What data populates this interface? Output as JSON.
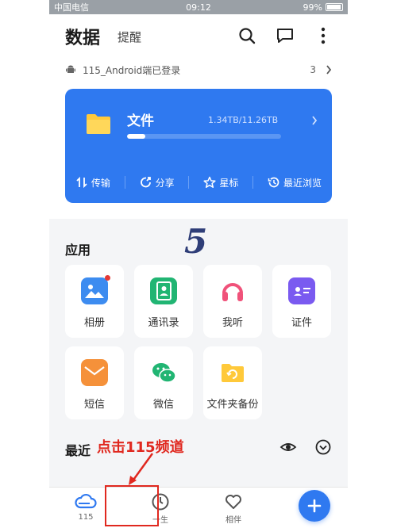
{
  "status_bar": {
    "carrier": "中国电信",
    "time": "09:12",
    "battery": "99%"
  },
  "header": {
    "title": "数据",
    "tab": "提醒"
  },
  "device": {
    "label": "115_Android端已登录",
    "count": "3"
  },
  "card": {
    "name": "文件",
    "usage": "1.34TB/11.26TB",
    "progress_fraction": 0.12,
    "actions": [
      "传输",
      "分享",
      "星标",
      "最近浏览"
    ]
  },
  "watermark": "5",
  "apps": {
    "title": "应用",
    "items": [
      "相册",
      "通讯录",
      "我听",
      "证件",
      "短信",
      "微信",
      "文件夹备份"
    ]
  },
  "recent": {
    "title": "最近",
    "annotation": "点击115频道"
  },
  "tabbar": {
    "items": [
      "115",
      "一生",
      "相伴"
    ]
  },
  "colors": {
    "accent": "#2f79f0",
    "annotation": "#e0281f"
  }
}
